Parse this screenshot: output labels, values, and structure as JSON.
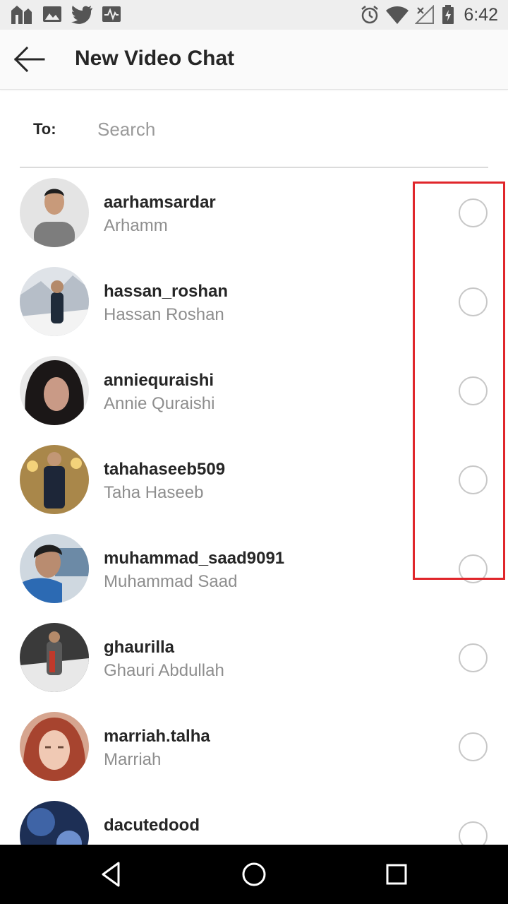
{
  "status_bar": {
    "time": "6:42",
    "icons_left": [
      "home-app-icon",
      "gallery-icon",
      "twitter-icon",
      "activity-icon"
    ],
    "icons_right": [
      "alarm-icon",
      "wifi-icon",
      "no-signal-icon",
      "battery-charging-icon"
    ]
  },
  "header": {
    "title": "New Video Chat",
    "back_icon": "arrow-left-icon"
  },
  "search": {
    "to_label": "To:",
    "placeholder": "Search",
    "value": ""
  },
  "contacts": [
    {
      "username": "aarhamsardar",
      "name": "Arhamm",
      "selected": false,
      "avatar_color": "#8a8a8a"
    },
    {
      "username": "hassan_roshan",
      "name": "Hassan Roshan",
      "selected": false,
      "avatar_color": "#d9dde2"
    },
    {
      "username": "anniequraishi",
      "name": "Annie Quraishi",
      "selected": false,
      "avatar_color": "#1e1b1b"
    },
    {
      "username": "tahahaseeb509",
      "name": "Taha Haseeb",
      "selected": false,
      "avatar_color": "#a9874a"
    },
    {
      "username": "muhammad_saad9091",
      "name": "Muhammad Saad",
      "selected": false,
      "avatar_color": "#3c5872"
    },
    {
      "username": "ghaurilla",
      "name": "Ghauri Abdullah",
      "selected": false,
      "avatar_color": "#4d4d4d"
    },
    {
      "username": "marriah.talha",
      "name": "Marriah",
      "selected": false,
      "avatar_color": "#c98a74"
    },
    {
      "username": "dacutedood",
      "name": "",
      "selected": false,
      "avatar_color": "#1d2f55"
    }
  ],
  "annotation": {
    "color": "#e0262b"
  },
  "nav_bar": {
    "buttons": [
      "back-triangle-icon",
      "home-circle-icon",
      "recents-square-icon"
    ]
  }
}
